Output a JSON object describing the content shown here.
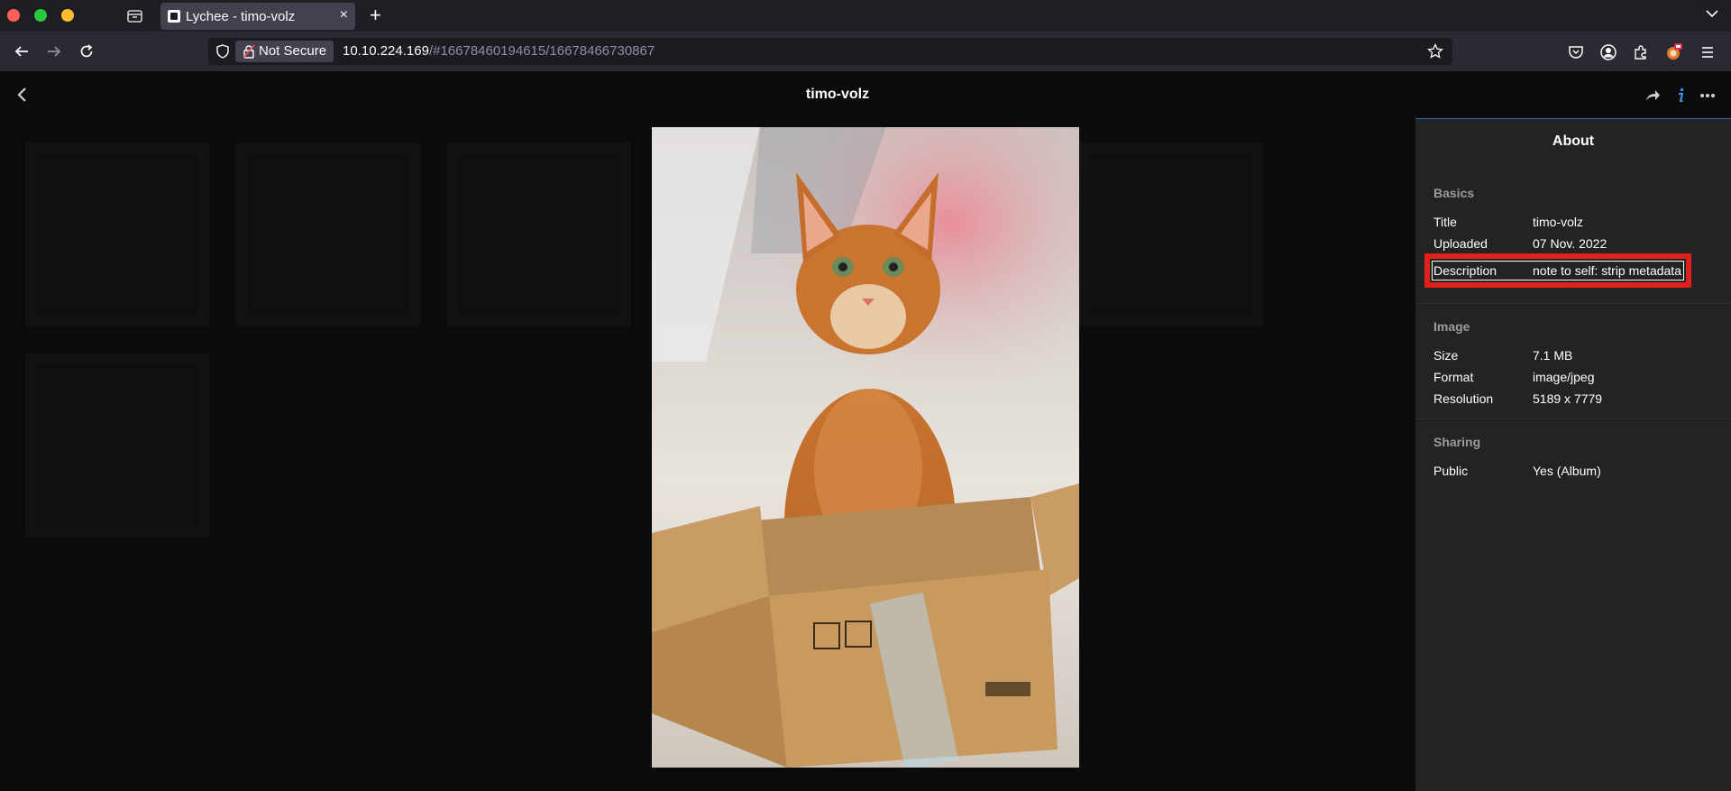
{
  "browser": {
    "tab": {
      "title": "Lychee - timo-volz",
      "close": "×"
    },
    "new_tab": "+",
    "security_label": "Not Secure",
    "url": {
      "host": "10.10.224.169",
      "rest": "/#16678460194615/16678466730867"
    }
  },
  "header": {
    "title": "timo-volz"
  },
  "sidebar": {
    "heading": "About",
    "basics": {
      "label": "Basics",
      "rows": [
        {
          "key": "Title",
          "value": "timo-volz"
        },
        {
          "key": "Uploaded",
          "value": "07 Nov. 2022"
        },
        {
          "key": "Description",
          "value": "note to self: strip metadata"
        }
      ]
    },
    "image": {
      "label": "Image",
      "rows": [
        {
          "key": "Size",
          "value": "7.1 MB"
        },
        {
          "key": "Format",
          "value": "image/jpeg"
        },
        {
          "key": "Resolution",
          "value": "5189 x 7779"
        }
      ]
    },
    "sharing": {
      "label": "Sharing",
      "rows": [
        {
          "key": "Public",
          "value": "Yes (Album)"
        }
      ]
    }
  },
  "colors": {
    "highlight": "#e0201b",
    "accent": "#2a6fbb",
    "sidebar_bg": "#232323"
  }
}
